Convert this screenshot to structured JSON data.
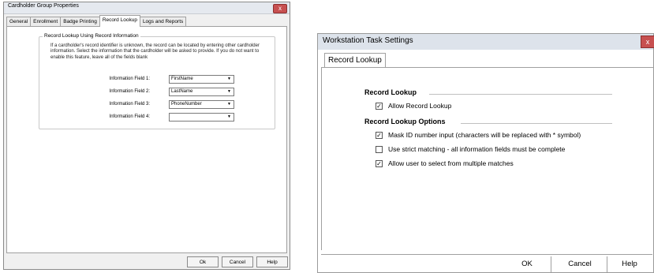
{
  "left_dialog": {
    "title": "Cardholder Group Properties",
    "close_symbol": "x",
    "tabs": [
      "General",
      "Enrollment",
      "Badge Printing",
      "Record Lookup",
      "Logs and Reports"
    ],
    "active_tab": "Record Lookup",
    "group_title": "Record Lookup Using Record Information",
    "description": "If a cardholder's record identifier is unknown, the record can be located by entering other cardholder information. Select the information that the cardholder will be asked to provide. If you do not want to enable this feature, leave all of the fields blank",
    "fields": [
      {
        "label": "Information Field 1:",
        "value": "FirstName"
      },
      {
        "label": "Information Field 2:",
        "value": "LastName"
      },
      {
        "label": "Information Field 3:",
        "value": "PhoneNumber"
      },
      {
        "label": "Information Field 4:",
        "value": ""
      }
    ],
    "buttons": {
      "ok": "Ok",
      "cancel": "Cancel",
      "help": "Help"
    }
  },
  "right_dialog": {
    "title": "Workstation Task Settings",
    "close_symbol": "x",
    "tab": "Record Lookup",
    "section1_title": "Record Lookup",
    "allow_lookup": {
      "label": "Allow Record Lookup",
      "checked": true
    },
    "section2_title": "Record Lookup Options",
    "options": [
      {
        "label": "Mask ID number input (characters will be replaced with * symbol)",
        "checked": true
      },
      {
        "label": "Use strict matching - all information fields must be complete",
        "checked": false
      },
      {
        "label": "Allow user to select from multiple matches",
        "checked": true
      }
    ],
    "buttons": {
      "ok": "OK",
      "cancel": "Cancel",
      "help": "Help"
    }
  },
  "colors": {
    "close_button": "#c75050",
    "titlebar": "#dde3eb"
  }
}
